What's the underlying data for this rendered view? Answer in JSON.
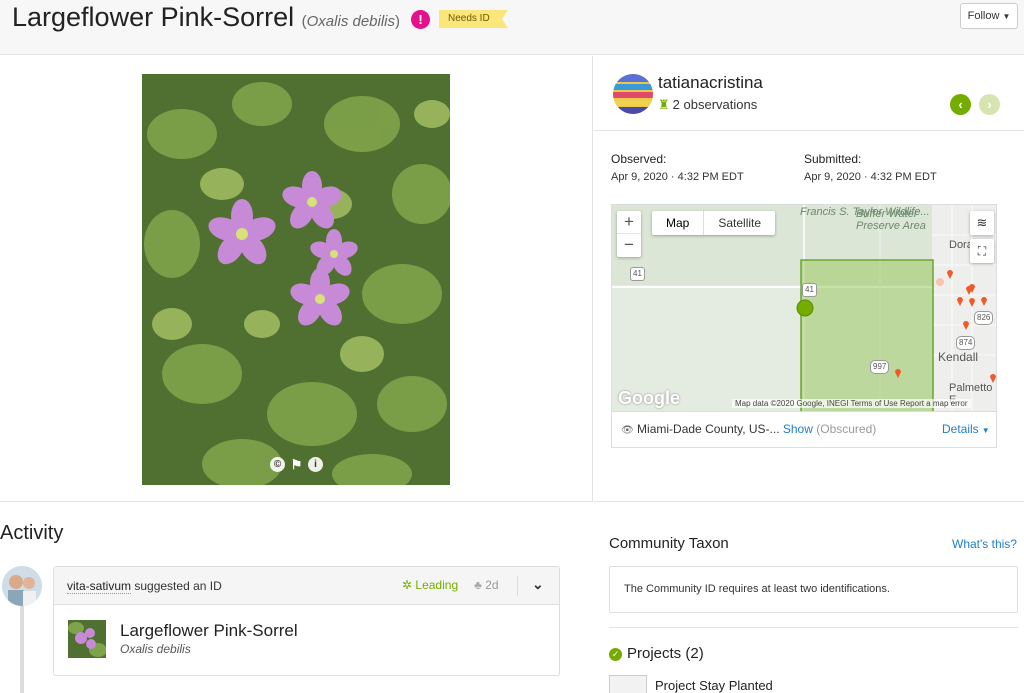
{
  "header": {
    "common_name": "Largeflower Pink-Sorrel",
    "sci_open": "(",
    "scientific_name": "Oxalis debilis",
    "sci_close": ")",
    "alert_glyph": "!",
    "status_badge": "Needs ID",
    "follow_label": "Follow"
  },
  "photo": {
    "icons": [
      "copyright-icon",
      "flag-icon",
      "info-icon"
    ]
  },
  "observer": {
    "username": "tatianacristina",
    "observations": "2 observations"
  },
  "dates": {
    "observed_label": "Observed:",
    "observed_value": "Apr 9, 2020 · 4:32 PM EDT",
    "submitted_label": "Submitted:",
    "submitted_value": "Apr 9, 2020 · 4:32 PM EDT"
  },
  "map": {
    "zoom_in": "+",
    "zoom_out": "−",
    "type_map": "Map",
    "type_satellite": "Satellite",
    "label_francis": "Francis S. Taylor Wildlife...",
    "label_buffer": "Buffer Water Preserve Area",
    "label_dora": "Dora",
    "label_kendall": "Kendall",
    "label_palmetto": "Palmetto E",
    "road_41": "41",
    "road_41b": "41",
    "road_826": "826",
    "road_874": "874",
    "road_997": "997",
    "google": "Google",
    "attribution": "Map data ©2020 Google, INEGI   Terms of Use   Report a map error",
    "place": "Miami-Dade County, US-...",
    "show_link": "Show",
    "obscured": "(Obscured)",
    "details": "Details"
  },
  "activity": {
    "title": "Activity",
    "ident_user": "vita-sativum",
    "ident_action": "suggested an ID",
    "leading": "Leading",
    "age": "2d",
    "taxon_name": "Largeflower Pink-Sorrel",
    "taxon_sci": "Oxalis debilis"
  },
  "community_taxon": {
    "title": "Community Taxon",
    "whats_this": "What's this?",
    "message": "The Community ID requires at least two identifications."
  },
  "projects": {
    "title": "Projects (2)",
    "first": "Project Stay Planted"
  },
  "colors": {
    "accent": "#74ac00",
    "link": "#1f7fc7",
    "alert": "#e5118c",
    "badge": "#fbe67a"
  }
}
